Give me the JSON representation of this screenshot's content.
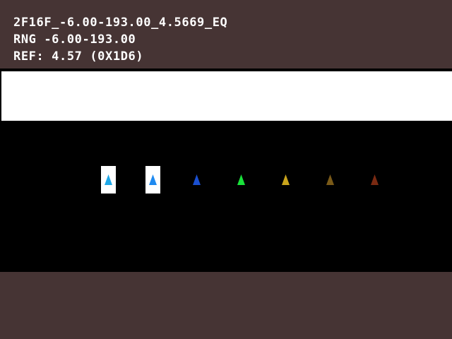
{
  "hud": {
    "line1": "2F16F_-6.00-193.00_4.5669_EQ",
    "line2": "RNG -6.00-193.00",
    "line3": "REF: 4.57 (0X1D6)"
  },
  "markers": [
    {
      "name": "marker-1",
      "color": "#1fa8e8",
      "selected": true
    },
    {
      "name": "marker-2",
      "color": "#1f8af0",
      "selected": true
    },
    {
      "name": "marker-3",
      "color": "#1a4fd0",
      "selected": false
    },
    {
      "name": "marker-4",
      "color": "#19e13a",
      "selected": false
    },
    {
      "name": "marker-5",
      "color": "#c9a41c",
      "selected": false
    },
    {
      "name": "marker-6",
      "color": "#7a5a18",
      "selected": false
    },
    {
      "name": "marker-7",
      "color": "#7a2a12",
      "selected": false
    }
  ],
  "colors": {
    "background": "#463434",
    "stage": "#000000",
    "band": "#ffffff",
    "text": "#ffffff"
  }
}
